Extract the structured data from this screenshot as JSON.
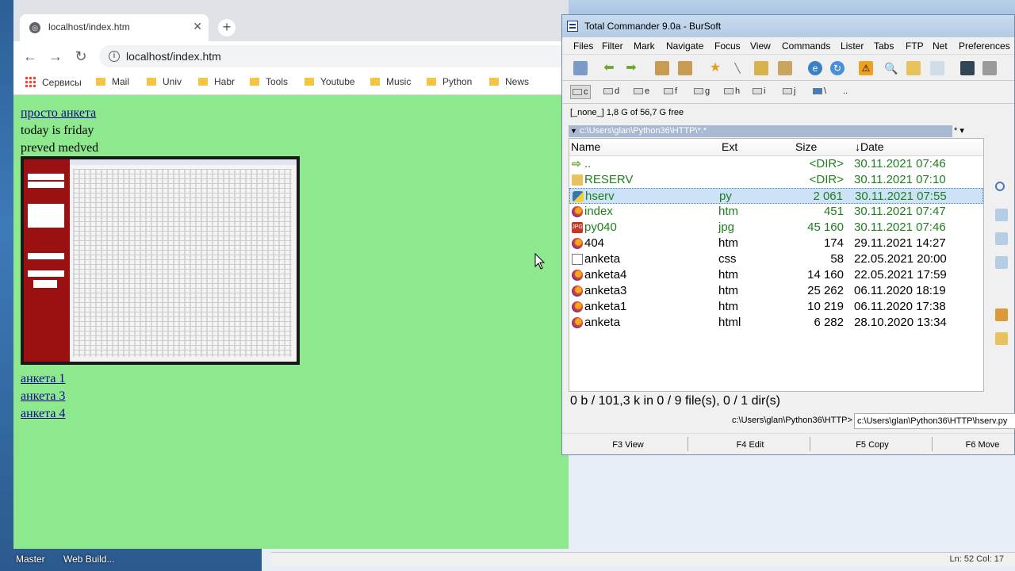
{
  "desktop": {
    "taskbar": [
      "Master",
      "Web Build..."
    ],
    "editor_status": "Ln: 52   Col: 17"
  },
  "browser": {
    "tab_title": "localhost/index.htm",
    "url": "localhost/index.htm",
    "bookmarks": [
      "Сервисы",
      "Mail",
      "Univ",
      "Habr",
      "Tools",
      "Youtube",
      "Music",
      "Python",
      "News"
    ],
    "page": {
      "link_top": "просто анкета",
      "line1": "today is friday",
      "line2": "preved medved",
      "links": [
        "анкета 1",
        "анкета 3",
        "анкета 4"
      ]
    }
  },
  "tc": {
    "title": "Total Commander 9.0a - BurSoft",
    "menu": [
      "Files",
      "Filter",
      "Mark",
      "Navigate",
      "Focus",
      "View",
      "Commands",
      "Lister",
      "Tabs",
      "FTP",
      "Net",
      "Preferences"
    ],
    "drives": [
      "c",
      "d",
      "e",
      "f",
      "g",
      "h",
      "i",
      "j",
      "\\",
      ".."
    ],
    "free_label": "[_none_]  1,8 G of 56,7 G free",
    "path": "c:\\Users\\glan\\Python36\\HTTP\\*.*",
    "path_btns": "*  ▾",
    "columns": {
      "name": "Name",
      "ext": "Ext",
      "size": "Size",
      "date": "↓Date"
    },
    "files": [
      {
        "name": "..",
        "ext": "",
        "size": "<DIR>",
        "date": "30.11.2021 07:46",
        "icon": "up-icon",
        "color": "#1f7f1f"
      },
      {
        "name": "RESERV",
        "ext": "",
        "size": "<DIR>",
        "date": "30.11.2021 07:10",
        "icon": "folder-icon",
        "color": "#1f7f1f"
      },
      {
        "name": "hserv",
        "ext": "py",
        "size": "2 061",
        "date": "30.11.2021 07:55",
        "icon": "python-icon",
        "color": "#1f7f1f"
      },
      {
        "name": "index",
        "ext": "htm",
        "size": "451",
        "date": "30.11.2021 07:47",
        "icon": "firefox-icon",
        "color": "#1f7f1f"
      },
      {
        "name": "py040",
        "ext": "jpg",
        "size": "45 160",
        "date": "30.11.2021 07:46",
        "icon": "jpg-icon",
        "color": "#1f7f1f"
      },
      {
        "name": "404",
        "ext": "htm",
        "size": "174",
        "date": "29.11.2021 14:27",
        "icon": "firefox-icon",
        "color": "#000000"
      },
      {
        "name": "anketa",
        "ext": "css",
        "size": "58",
        "date": "22.05.2021 20:00",
        "icon": "css-icon",
        "color": "#000000"
      },
      {
        "name": "anketa4",
        "ext": "htm",
        "size": "14 160",
        "date": "22.05.2021 17:59",
        "icon": "firefox-icon",
        "color": "#000000"
      },
      {
        "name": "anketa3",
        "ext": "htm",
        "size": "25 262",
        "date": "06.11.2020 18:19",
        "icon": "firefox-icon",
        "color": "#000000"
      },
      {
        "name": "anketa1",
        "ext": "htm",
        "size": "10 219",
        "date": "06.11.2020 17:38",
        "icon": "firefox-icon",
        "color": "#000000"
      },
      {
        "name": "anketa",
        "ext": "html",
        "size": "6 282",
        "date": "28.10.2020 13:34",
        "icon": "firefox-icon",
        "color": "#000000"
      }
    ],
    "selected_row": 2,
    "summary": "0 b / 101,3 k in 0 / 9 file(s), 0 / 1 dir(s)",
    "cmd_path": "c:\\Users\\glan\\Python36\\HTTP>",
    "cmd_input": "c:\\Users\\glan\\Python36\\HTTP\\hserv.py",
    "fkeys": [
      "F3 View",
      "F4 Edit",
      "F5 Copy",
      "F6 Move"
    ]
  }
}
